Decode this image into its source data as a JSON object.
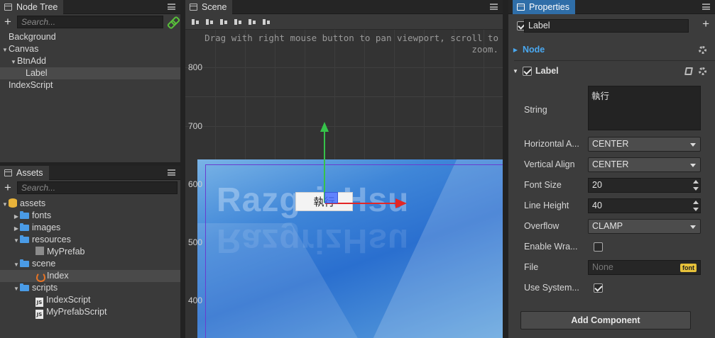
{
  "node_tree": {
    "tab": "Node Tree",
    "search_placeholder": "Search...",
    "items": [
      "Background",
      "Canvas",
      "BtnAdd",
      "Label",
      "IndexScript"
    ]
  },
  "assets": {
    "tab": "Assets",
    "search_placeholder": "Search...",
    "items": [
      "assets",
      "fonts",
      "images",
      "resources",
      "MyPrefab",
      "scene",
      "Index",
      "scripts",
      "IndexScript",
      "MyPrefabScript"
    ]
  },
  "scene": {
    "tab": "Scene",
    "hint": "Drag with right mouse button to pan viewport, scroll to zoom.",
    "rulers": [
      "800",
      "700",
      "600",
      "500",
      "400"
    ],
    "watermark": "RazgrizHsu",
    "button_text": "執行"
  },
  "properties": {
    "tab": "Properties",
    "node_name": "Label",
    "node_section": "Node",
    "label_section": "Label",
    "fields": {
      "string_label": "String",
      "string_value": "執行",
      "h_align_label": "Horizontal A...",
      "h_align_value": "CENTER",
      "v_align_label": "Vertical Align",
      "v_align_value": "CENTER",
      "font_size_label": "Font Size",
      "font_size_value": "20",
      "line_height_label": "Line Height",
      "line_height_value": "40",
      "overflow_label": "Overflow",
      "overflow_value": "CLAMP",
      "enable_wrap_label": "Enable Wra...",
      "file_label": "File",
      "file_value": "None",
      "file_tag": "font",
      "use_system_label": "Use System..."
    },
    "add_component": "Add Component"
  },
  "colors": {
    "accent": "#2f6ea8",
    "node_section_text": "#4aa8f0",
    "gizmo_y": "#36c24a",
    "gizmo_x": "#e32626"
  }
}
